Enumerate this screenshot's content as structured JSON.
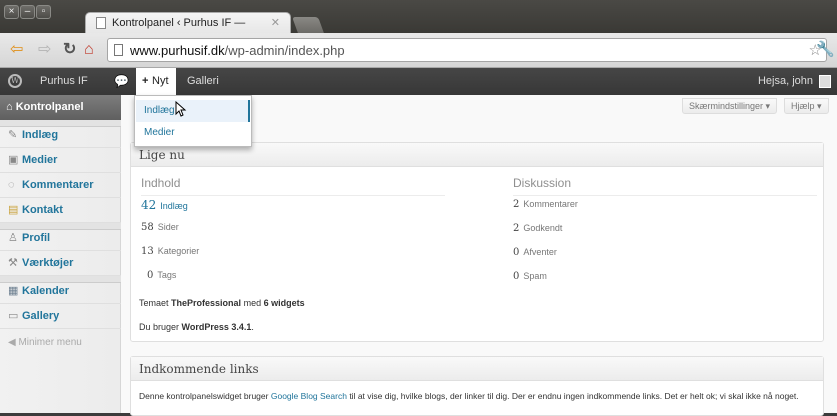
{
  "browser": {
    "tab_title": "Kontrolpanel ‹ Purhus IF —",
    "url_host": "www.purhusif.dk",
    "url_path": "/wp-admin/index.php"
  },
  "adminbar": {
    "site_name": "Purhus IF",
    "new_label": "Nyt",
    "gallery_label": "Galleri",
    "greeting": "Hejsa, john"
  },
  "new_menu": [
    "Indlæg",
    "Medier"
  ],
  "sidebar": {
    "active": "Kontrolpanel",
    "items": [
      {
        "label": "Indlæg",
        "icon": "pin-icon"
      },
      {
        "label": "Medier",
        "icon": "media-icon"
      },
      {
        "label": "Kommentarer",
        "icon": "comment-icon"
      },
      {
        "label": "Kontakt",
        "icon": "contact-icon"
      },
      {
        "label": "Profil",
        "icon": "users-icon"
      },
      {
        "label": "Værktøjer",
        "icon": "tools-icon"
      },
      {
        "label": "Kalender",
        "icon": "calendar-icon"
      },
      {
        "label": "Gallery",
        "icon": "gallery-icon"
      }
    ],
    "collapse": "Minimer menu"
  },
  "screen_options": "Skærmindstillinger",
  "help": "Hjælp",
  "right_now": {
    "title": "Lige nu",
    "content_heading": "Indhold",
    "discussion_heading": "Diskussion",
    "content": [
      {
        "n": "42",
        "label": "Indlæg"
      },
      {
        "n": "58",
        "label": "Sider"
      },
      {
        "n": "13",
        "label": "Kategorier"
      },
      {
        "n": "0",
        "label": "Tags"
      }
    ],
    "discussion": [
      {
        "n": "2",
        "label": "Kommentarer"
      },
      {
        "n": "2",
        "label": "Godkendt"
      },
      {
        "n": "0",
        "label": "Afventer"
      },
      {
        "n": "0",
        "label": "Spam"
      }
    ],
    "theme_prefix": "Temaet",
    "theme_name": "TheProfessional",
    "theme_mid": "med",
    "theme_widgets": "6 widgets",
    "version_prefix": "Du bruger",
    "version": "WordPress 3.4.1",
    "version_suffix": "."
  },
  "incoming": {
    "title": "Indkommende links",
    "text_before": "Denne kontrolpanelswidget bruger",
    "link": "Google Blog Search",
    "text_after": "til at vise dig, hvilke blogs, der linker til dig. Der er endnu ingen indkommende links. Det er helt ok; vi skal ikke nå noget."
  }
}
